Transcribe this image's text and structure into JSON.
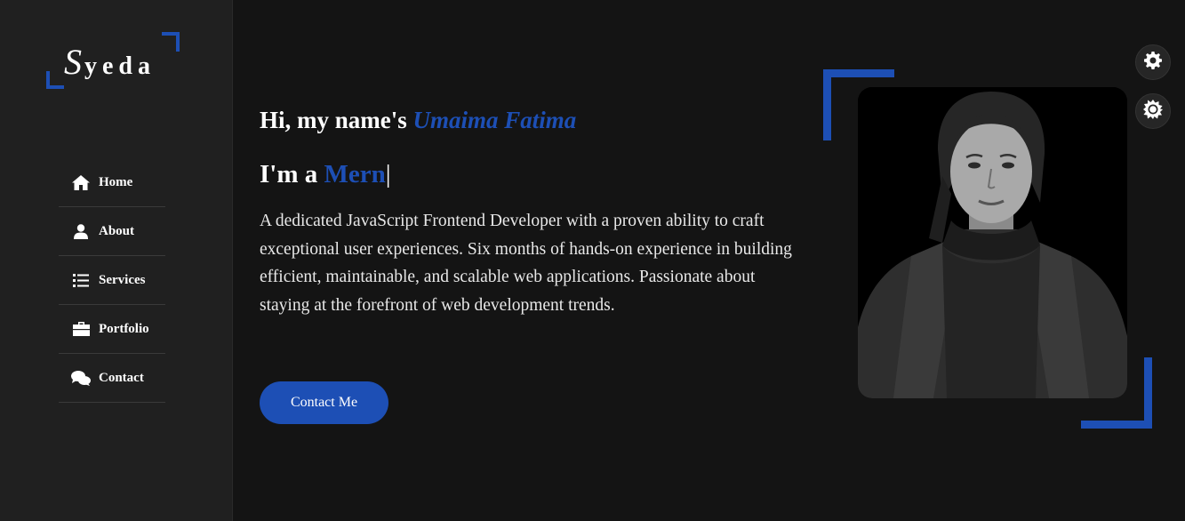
{
  "logo": {
    "first_letter": "S",
    "rest": "yeda"
  },
  "nav": {
    "items": [
      {
        "label": "Home",
        "icon": "home-icon"
      },
      {
        "label": "About",
        "icon": "user-icon"
      },
      {
        "label": "Services",
        "icon": "list-icon"
      },
      {
        "label": "Portfolio",
        "icon": "briefcase-icon"
      },
      {
        "label": "Contact",
        "icon": "chat-icon"
      }
    ]
  },
  "hero": {
    "greeting_prefix": "Hi, my name's",
    "name": "Umaima Fatima",
    "role_prefix": "I'm a",
    "role_word": "Mern",
    "cursor": "|",
    "bio": "A dedicated JavaScript Frontend Developer with a proven ability to craft exceptional user experiences. Six months of hands-on experience in building efficient, maintainable, and scalable web applications. Passionate about staying at the forefront of web development trends.",
    "cta_label": "Contact Me"
  },
  "controls": {
    "settings_icon": "gear-icon",
    "theme_icon": "sun-icon"
  },
  "colors": {
    "accent": "#1d4fb5",
    "background": "#141414",
    "sidebar": "#202020"
  }
}
